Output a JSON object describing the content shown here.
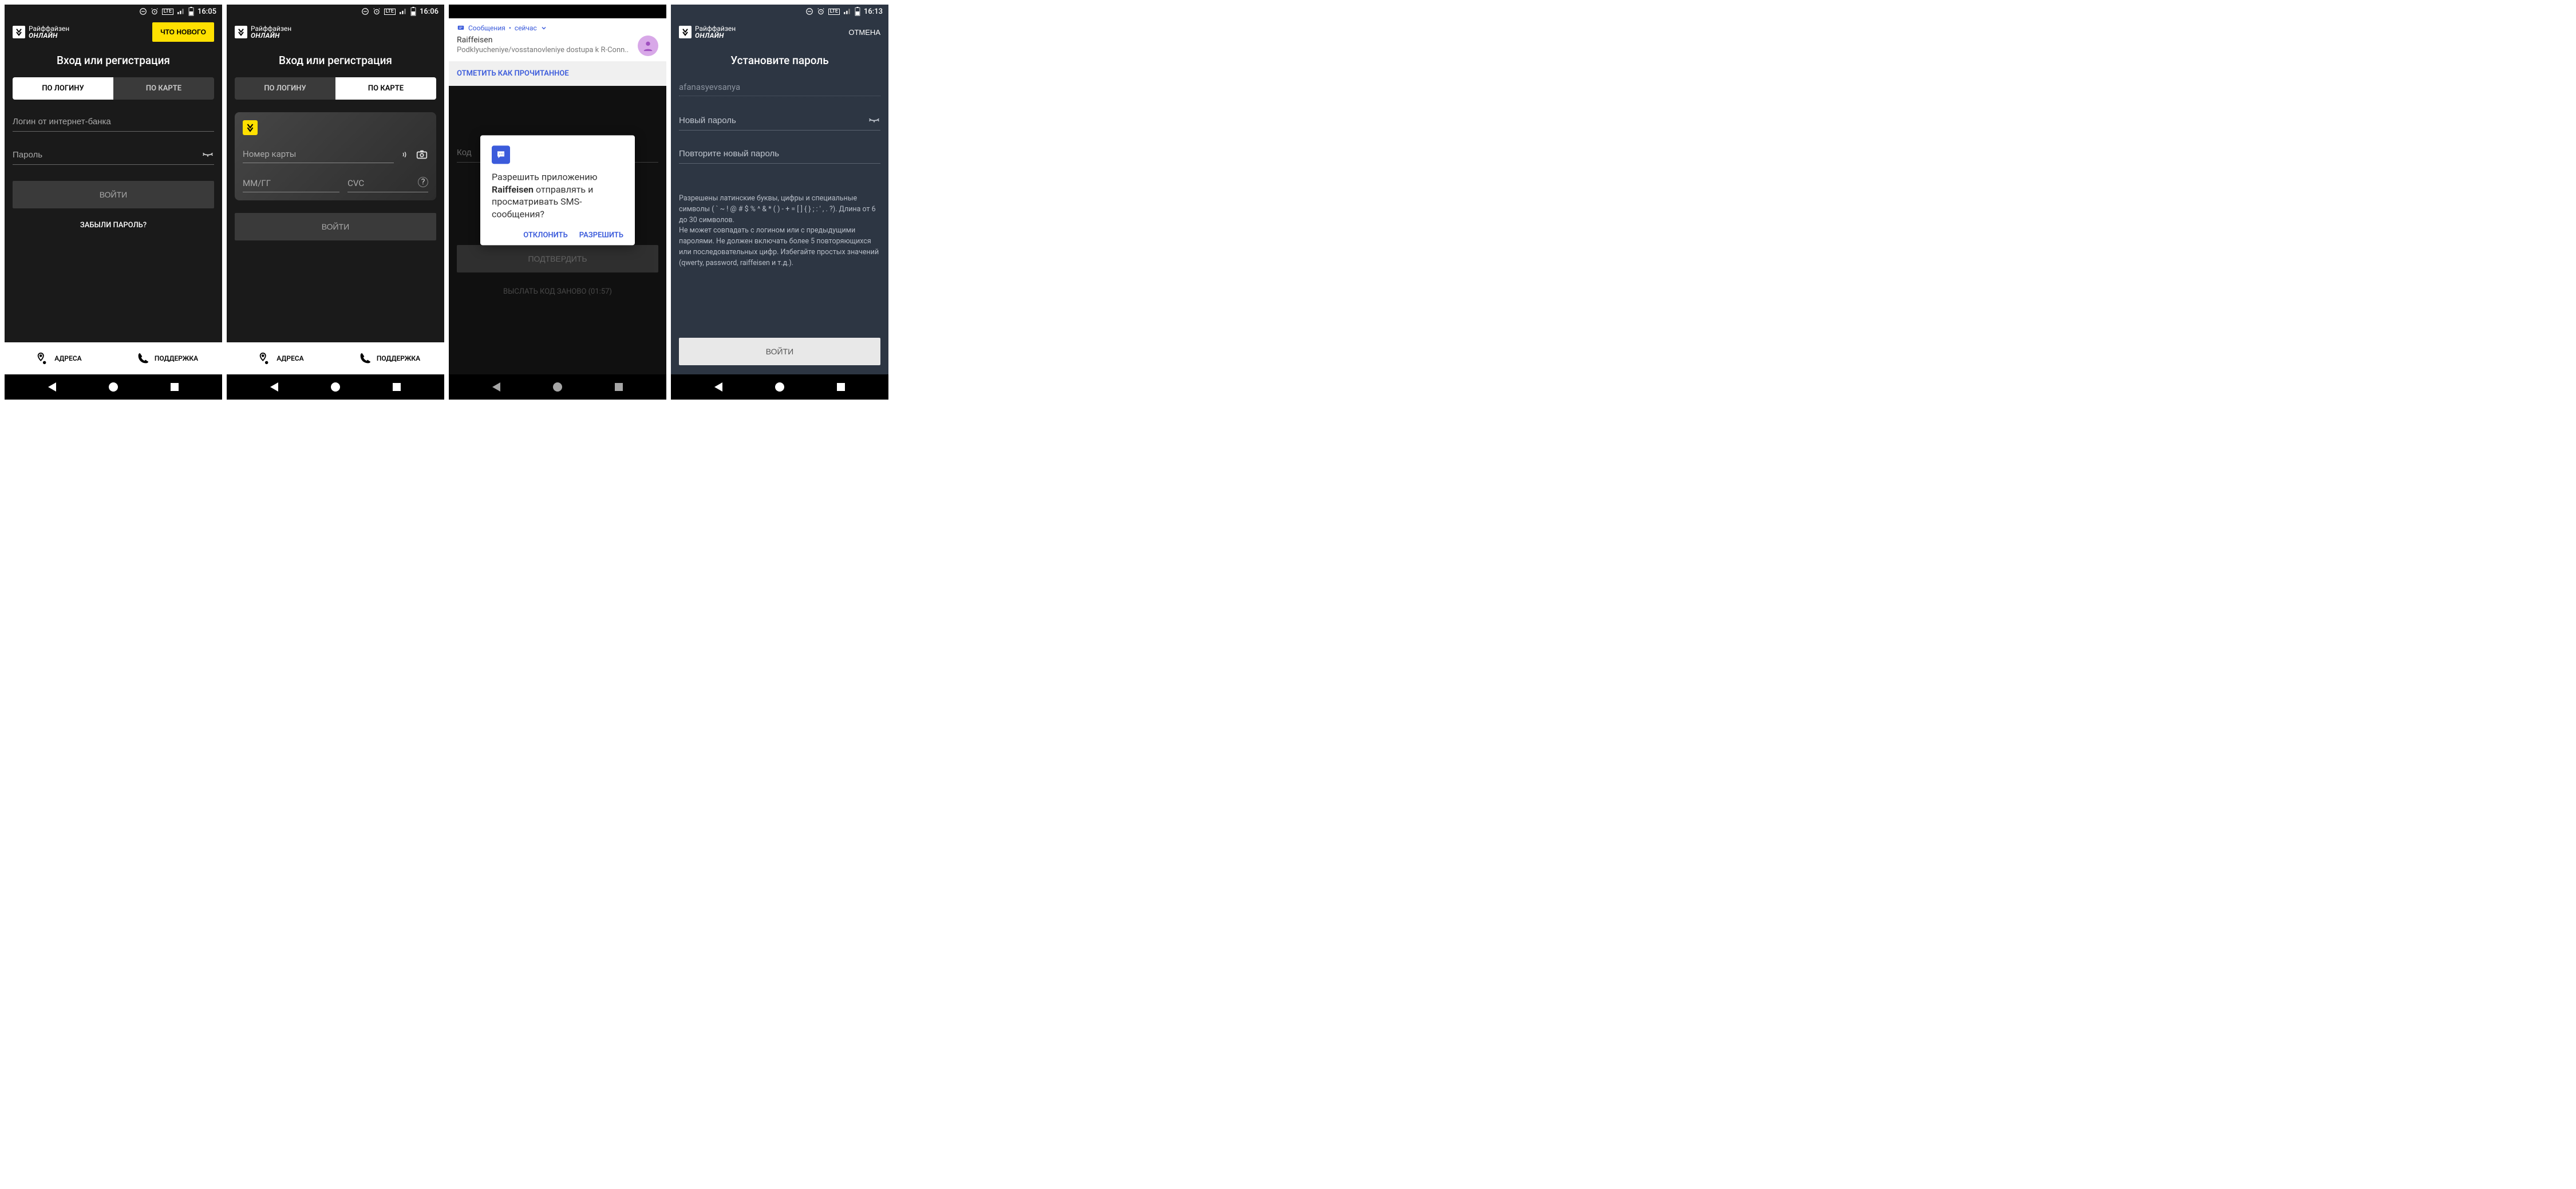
{
  "screens": [
    {
      "status_time": "16:05",
      "logo_line1": "Райффайзен",
      "logo_line2": "ОНЛАЙН",
      "whats_new": "ЧТО НОВОГО",
      "title": "Вход или регистрация",
      "tab_login": "ПО ЛОГИНУ",
      "tab_card": "ПО КАРТЕ",
      "login_placeholder": "Логин от интернет-банка",
      "password_placeholder": "Пароль",
      "login_btn": "ВОЙТИ",
      "forgot": "ЗАБЫЛИ ПАРОЛЬ?",
      "addresses": "АДРЕСА",
      "support": "ПОДДЕРЖКА"
    },
    {
      "status_time": "16:06",
      "logo_line1": "Райффайзен",
      "logo_line2": "ОНЛАЙН",
      "title": "Вход или регистрация",
      "tab_login": "ПО ЛОГИНУ",
      "tab_card": "ПО КАРТЕ",
      "card_number_ph": "Номер карты",
      "mmgg_ph": "ММ/ГГ",
      "cvc_ph": "CVC",
      "login_btn": "ВОЙТИ",
      "addresses": "АДРЕСА",
      "support": "ПОДДЕРЖКА"
    },
    {
      "notif_app": "Сообщения",
      "notif_time": "сейчас",
      "notif_sender": "Raiffeisen",
      "notif_body": "Podklyucheniye/vosstanovleniye dostupa k R-Conn..",
      "notif_mark_read": "ОТМЕТИТЬ КАК ПРОЧИТАННОЕ",
      "code_placeholder": "Код",
      "confirm_btn": "ПОДТВЕРДИТЬ",
      "resend": "ВЫСЛАТЬ КОД ЗАНОВО (01:57)",
      "dialog_line1": "Разрешить приложению",
      "dialog_app": "Raiffeisen",
      "dialog_line2": "отправлять и просматривать SMS-сообщения?",
      "dialog_deny": "ОТКЛОНИТЬ",
      "dialog_allow": "РАЗРЕШИТЬ"
    },
    {
      "status_time": "16:13",
      "logo_line1": "Райффайзен",
      "logo_line2": "ОНЛАЙН",
      "cancel": "ОТМЕНА",
      "title": "Установите пароль",
      "username": "afanasyevsanya",
      "new_pw_ph": "Новый пароль",
      "repeat_pw_ph": "Повторите новый пароль",
      "helper1": "Разрешены латинские буквы, цифры и специальные символы ( ` ~ ! @ # $ % ^ & * ( ) - + = [ ] { } ; : ' , . ?). Длина от 6 до 30 символов.",
      "helper2": "Не может совпадать с логином или с предыдущими паролями. Не должен включать более 5 повторяющихся или последовательных цифр. Избегайте простых значений (qwerty, password, raiffeisen и т.д.).",
      "login_btn": "ВОЙТИ"
    }
  ]
}
